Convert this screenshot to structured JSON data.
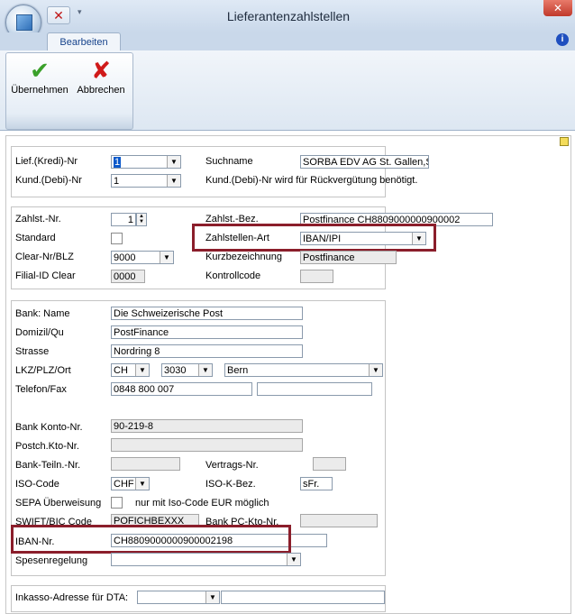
{
  "window": {
    "title": "Lieferantenzahlstellen",
    "close_glyph": "✕",
    "qa_glyph": "✕",
    "qa_drop": "▾"
  },
  "ribbon": {
    "tab": "Bearbeiten",
    "info_glyph": "i",
    "buttons": [
      {
        "label": "Übernehmen",
        "glyph": "✔",
        "icon": "checkmark-icon",
        "color": "#3aa02a"
      },
      {
        "label": "Abbrechen",
        "glyph": "✘",
        "icon": "cross-icon",
        "color": "#d01a1a"
      }
    ]
  },
  "supplier": {
    "lief_label": "Lief.(Kredi)-Nr",
    "lief_value": "1",
    "kund_label": "Kund.(Debi)-Nr",
    "kund_value": "1",
    "suchname_label": "Suchname",
    "suchname_value": "SORBA EDV AG St. Gallen,Scl",
    "hint": "Kund.(Debi)-Nr wird für Rückvergütung benötigt."
  },
  "zahlstelle": {
    "nr_label": "Zahlst.-Nr.",
    "nr_value": "1",
    "bez_label": "Zahlst.-Bez.",
    "bez_value": "Postfinance CH8809000000900002",
    "standard_label": "Standard",
    "art_label": "Zahlstellen-Art",
    "art_value": "IBAN/IPI",
    "clear_label": "Clear-Nr/BLZ",
    "clear_value": "9000",
    "kurz_label": "Kurzbezeichnung",
    "kurz_value": "Postfinance",
    "filial_label": "Filial-ID Clear",
    "filial_value": "0000",
    "kontroll_label": "Kontrollcode",
    "kontroll_value": ""
  },
  "bank": {
    "name_label": "Bank: Name",
    "name_value": "Die Schweizerische Post",
    "domizil_label": "Domizil/Qu",
    "domizil_value": "PostFinance",
    "strasse_label": "Strasse",
    "strasse_value": "Nordring 8",
    "lkz_label": "LKZ/PLZ/Ort",
    "lkz_value": "CH",
    "plz_value": "3030",
    "ort_value": "Bern",
    "tel_label": "Telefon/Fax",
    "tel_value": "0848 800 007",
    "fax_value": "",
    "konto_label": "Bank Konto-Nr.",
    "konto_value": "90-219-8",
    "postch_label": "Postch.Kto-Nr.",
    "postch_value": "",
    "teiln_label": "Bank-Teiln.-Nr.",
    "teiln_value": "",
    "vertrags_label": "Vertrags-Nr.",
    "vertrags_value": "",
    "iso_label": "ISO-Code",
    "iso_value": "CHF",
    "isok_label": "ISO-K-Bez.",
    "isok_value": "sFr.",
    "sepa_label": "SEPA Überweisung",
    "sepa_hint": "nur mit Iso-Code EUR möglich",
    "swift_label": "SWIFT/BIC Code",
    "swift_value": "POFICHBEXXX",
    "pc_label": "Bank PC-Kto-Nr.",
    "pc_value": "",
    "iban_label": "IBAN-Nr.",
    "iban_value": "CH8809000000900002198",
    "spesen_label": "Spesenregelung",
    "spesen_value": ""
  },
  "inkasso": {
    "label": "Inkasso-Adresse für DTA:",
    "value": "",
    "extra": ""
  },
  "colors": {
    "highlight": "#8b1e2b",
    "accent": "#15428b",
    "selection": "#0a58ca"
  }
}
